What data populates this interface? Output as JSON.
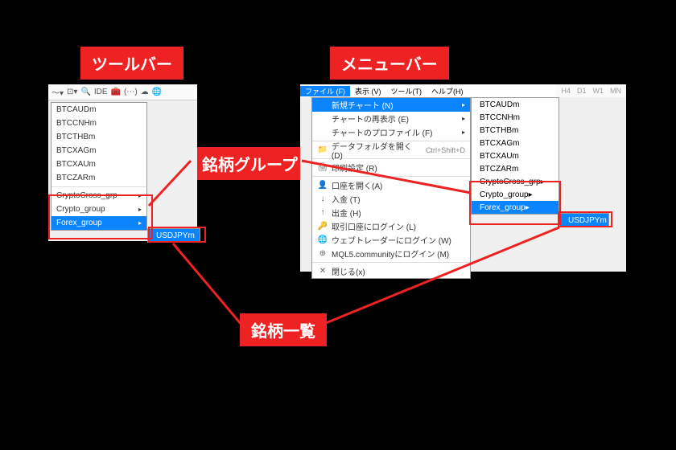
{
  "labels": {
    "toolbar": "ツールバー",
    "menubar": "メニューバー",
    "symbol_group": "銘柄グループ",
    "symbol_list": "銘柄一覧"
  },
  "toolbar": {
    "ide": "IDE",
    "symbols": [
      "BTCAUDm",
      "BTCCNHm",
      "BTCTHBm",
      "BTCXAGm",
      "BTCXAUm",
      "BTCZARm"
    ],
    "groups": [
      "CryptoCross_grp",
      "Crypto_group",
      "Forex_group"
    ],
    "sub": "USDJPYm"
  },
  "menubar": {
    "items": [
      "ファイル (F)",
      "表示 (V)",
      "ツール(T)",
      "ヘルプ(H)"
    ],
    "timeframes": [
      "H4",
      "D1",
      "W1",
      "MN"
    ],
    "menu": [
      {
        "t": "新規チャート (N)",
        "hl": true,
        "arrow": true
      },
      {
        "t": "チャートの再表示 (E)",
        "arrow": true
      },
      {
        "t": "チャートのプロファイル (F)",
        "arrow": true
      },
      {
        "sep": true
      },
      {
        "t": "データフォルダを開く(D)",
        "ic": "📁",
        "sh": "Ctrl+Shift+D"
      },
      {
        "sep": true
      },
      {
        "t": "印刷設定 (R)",
        "ic": "🖨"
      },
      {
        "sep": true
      },
      {
        "t": "口座を開く(A)",
        "ic": "👤"
      },
      {
        "t": "入金 (T)",
        "ic": "↓"
      },
      {
        "t": "出金 (H)",
        "ic": "↑"
      },
      {
        "t": "取引口座にログイン (L)",
        "ic": "🔑"
      },
      {
        "t": "ウェブトレーダーにログイン (W)",
        "ic": "🌐"
      },
      {
        "t": "MQL5.communityにログイン (M)",
        "ic": "⊕"
      },
      {
        "sep": true
      },
      {
        "t": "閉じる(x)",
        "ic": "✕"
      }
    ],
    "symbols": [
      "BTCAUDm",
      "BTCCNHm",
      "BTCTHBm",
      "BTCXAGm",
      "BTCXAUm",
      "BTCZARm"
    ],
    "groups": [
      "CryptoCross_grp",
      "Crypto_group",
      "Forex_group"
    ],
    "sub": "USDJPYm"
  }
}
